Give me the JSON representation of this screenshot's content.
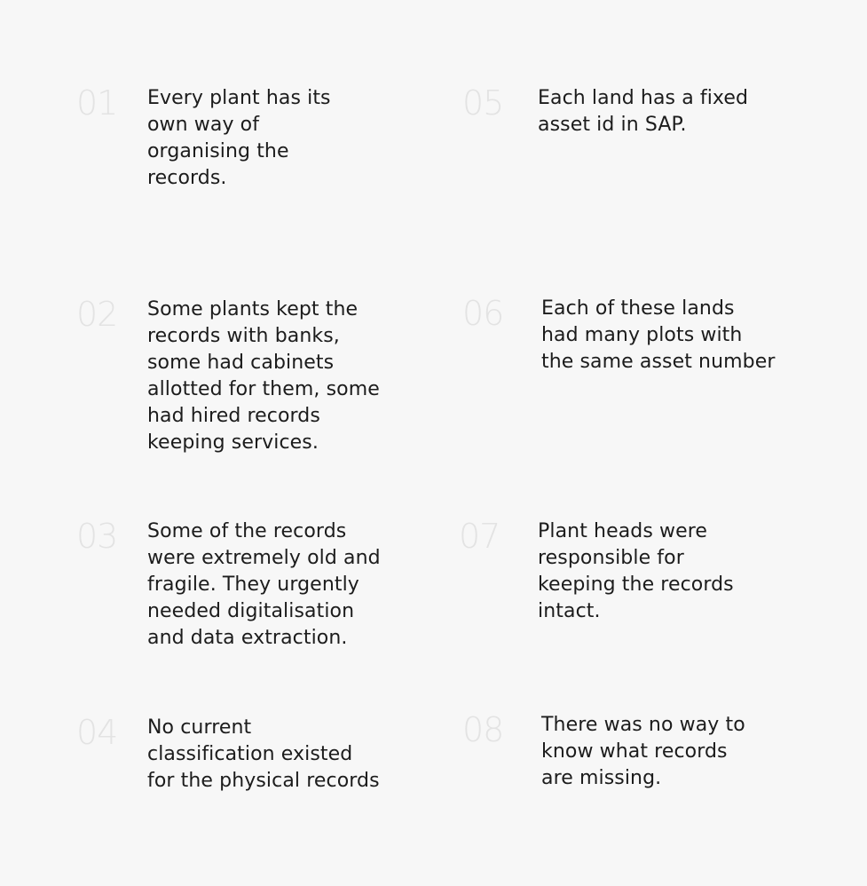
{
  "items": [
    {
      "num": "01",
      "text": "Every plant has its\nown way of\norganising the\nrecords."
    },
    {
      "num": "02",
      "text": "Some plants kept the\nrecords with banks,\nsome had cabinets\nallotted for them, some\nhad hired records\nkeeping services."
    },
    {
      "num": "03",
      "text": "Some of the records\nwere extremely old and\nfragile. They urgently\nneeded digitalisation\nand data extraction."
    },
    {
      "num": "04",
      "text": "No current\nclassification existed\nfor the physical records"
    },
    {
      "num": "05",
      "text": "Each land has a fixed\nasset id in SAP."
    },
    {
      "num": "06",
      "text": "Each of these lands\nhad many plots with\nthe same asset number"
    },
    {
      "num": "07",
      "text": "Plant heads were\nresponsible for\nkeeping the records\nintact."
    },
    {
      "num": "08",
      "text": "There was no way to\nknow what records\nare missing."
    }
  ]
}
